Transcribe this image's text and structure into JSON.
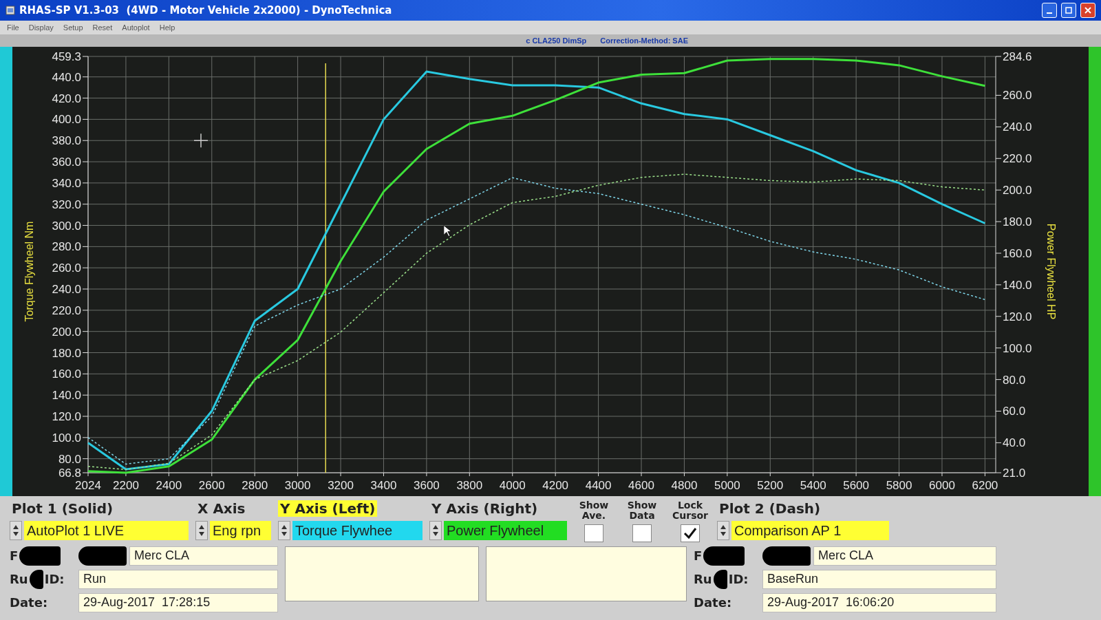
{
  "window": {
    "title": "RHAS-SP V1.3-03  (4WD - Motor Vehicle 2x2000) - DynoTechnica"
  },
  "menu": [
    "File",
    "Display",
    "Setup",
    "Reset",
    "Autoplot",
    "Help"
  ],
  "info_strip": [
    "c CLA250 DimSp",
    "Correction-Method: SAE"
  ],
  "chart": {
    "chart_data": {
      "type": "line",
      "ylabel": "Torque Flywheel Nm",
      "y2label": "Power Flywheel HP",
      "x": [
        2024,
        2200,
        2400,
        2600,
        2800,
        3000,
        3200,
        3400,
        3600,
        3800,
        4000,
        4200,
        4400,
        4600,
        4800,
        5000,
        5200,
        5400,
        5600,
        5800,
        6000,
        6200
      ],
      "xlim": [
        2024,
        6250
      ],
      "ylim": [
        66.8,
        459.3
      ],
      "y2lim": [
        21,
        284.6
      ],
      "xticks": [
        2024,
        2200,
        2400,
        2600,
        2800,
        3000,
        3200,
        3400,
        3600,
        3800,
        4000,
        4200,
        4400,
        4600,
        4800,
        5000,
        5200,
        5400,
        5600,
        5800,
        6000,
        6200
      ],
      "yticks": [
        66.8,
        {
          "value": 80,
          "label": "80.0"
        },
        {
          "value": 100,
          "label": "100.0"
        },
        {
          "value": 120,
          "label": "120.0"
        },
        {
          "value": 140,
          "label": "140.0"
        },
        {
          "value": 160,
          "label": "160.0"
        },
        {
          "value": 180,
          "label": "180.0"
        },
        {
          "value": 200,
          "label": "200.0"
        },
        {
          "value": 220,
          "label": "220.0"
        },
        {
          "value": 240,
          "label": "240.0"
        },
        {
          "value": 260,
          "label": "260.0"
        },
        {
          "value": 280,
          "label": "280.0"
        },
        {
          "value": 300,
          "label": "300.0"
        },
        {
          "value": 320,
          "label": "320.0"
        },
        {
          "value": 340,
          "label": "340.0"
        },
        {
          "value": 360,
          "label": "360.0"
        },
        {
          "value": 380,
          "label": "380.0"
        },
        {
          "value": 400,
          "label": "400.0"
        },
        {
          "value": 420,
          "label": "420.0"
        },
        {
          "value": 440,
          "label": "440.0"
        },
        459.3
      ],
      "y2ticks": [
        {
          "value": 21,
          "label": "21.0"
        },
        {
          "value": 40,
          "label": "40.0"
        },
        {
          "value": 60,
          "label": "60.0"
        },
        {
          "value": 80,
          "label": "80.0"
        },
        {
          "value": 100,
          "label": "100.0"
        },
        {
          "value": 120,
          "label": "120.0"
        },
        {
          "value": 140,
          "label": "140.0"
        },
        {
          "value": 160,
          "label": "160.0"
        },
        {
          "value": 180,
          "label": "180.0"
        },
        {
          "value": 200,
          "label": "200.0"
        },
        {
          "value": 220,
          "label": "220.0"
        },
        {
          "value": 240,
          "label": "240.0"
        },
        {
          "value": 260,
          "label": "260.0"
        },
        284.6
      ],
      "series": [
        {
          "color": "#29c9e0",
          "values": [
            95,
            70,
            75,
            125,
            210,
            240,
            320,
            400,
            445,
            438,
            432,
            432,
            430,
            415,
            405,
            400,
            385,
            370,
            352,
            340,
            320,
            302
          ]
        },
        {
          "color": "#3ee03a",
          "axis": "y2",
          "values": [
            22,
            21,
            25,
            42,
            80,
            105,
            155,
            199,
            226,
            242,
            247,
            257,
            268,
            273,
            274,
            282,
            283,
            283,
            282,
            279,
            272,
            266
          ]
        },
        {
          "color": "#7fd6ea",
          "line_style": "dashed",
          "values": [
            100,
            75,
            80,
            120,
            205,
            225,
            240,
            270,
            305,
            325,
            345,
            335,
            330,
            320,
            310,
            298,
            285,
            275,
            268,
            258,
            242,
            230
          ]
        },
        {
          "color": "#9be08a",
          "axis": "y2",
          "line_style": "dashed",
          "values": [
            25,
            23,
            27,
            45,
            80,
            92,
            110,
            135,
            160,
            178,
            192,
            196,
            203,
            208,
            210,
            208,
            206,
            205,
            207,
            206,
            202,
            200
          ]
        }
      ],
      "grid": true,
      "ref_lines": [
        {
          "axis": "x",
          "value": 3130,
          "color": "#e8dc50"
        }
      ]
    }
  },
  "selectors": [
    {
      "heading": "Plot 1 (Solid)",
      "value": "AutoPlot 1 LIVE",
      "color": "#ffff33",
      "highlighted": false
    },
    {
      "heading": "X Axis",
      "value": "Eng rpn",
      "color": "#ffff33",
      "highlighted": false
    },
    {
      "heading": "Y Axis (Left)",
      "value": "Torque Flywhee",
      "color": "#22d8ee",
      "highlighted": true
    },
    {
      "heading": "Y Axis (Right)",
      "value": "Power Flywheel",
      "color": "#22dd22",
      "highlighted": false
    }
  ],
  "checks": [
    {
      "label": "Show Ave.",
      "checked": false
    },
    {
      "label": "Show Data",
      "checked": false
    },
    {
      "label": "Lock Cursor",
      "checked": true
    }
  ],
  "plot2_selector": {
    "heading": "Plot 2 (Dash)",
    "value": "Comparison AP 1",
    "color": "#ffff33",
    "highlighted": false
  },
  "plot1_details": [
    {
      "label_start": "F",
      "value": "Merc CLA",
      "redacted": true
    },
    {
      "label_start": "Ru",
      "label_end": "ID:",
      "value": "Run",
      "redacted": true
    },
    {
      "label_start": "Date:",
      "value": "29-Aug-2017  17:28:15"
    }
  ],
  "plot2_details": [
    {
      "label_start": "F",
      "value": "Merc CLA",
      "redacted": true
    },
    {
      "label_start": "Ru",
      "label_end": "ID:",
      "value": "BaseRun",
      "redacted": true
    },
    {
      "label_start": "Date:",
      "value": "29-Aug-2017  16:06:20"
    }
  ]
}
